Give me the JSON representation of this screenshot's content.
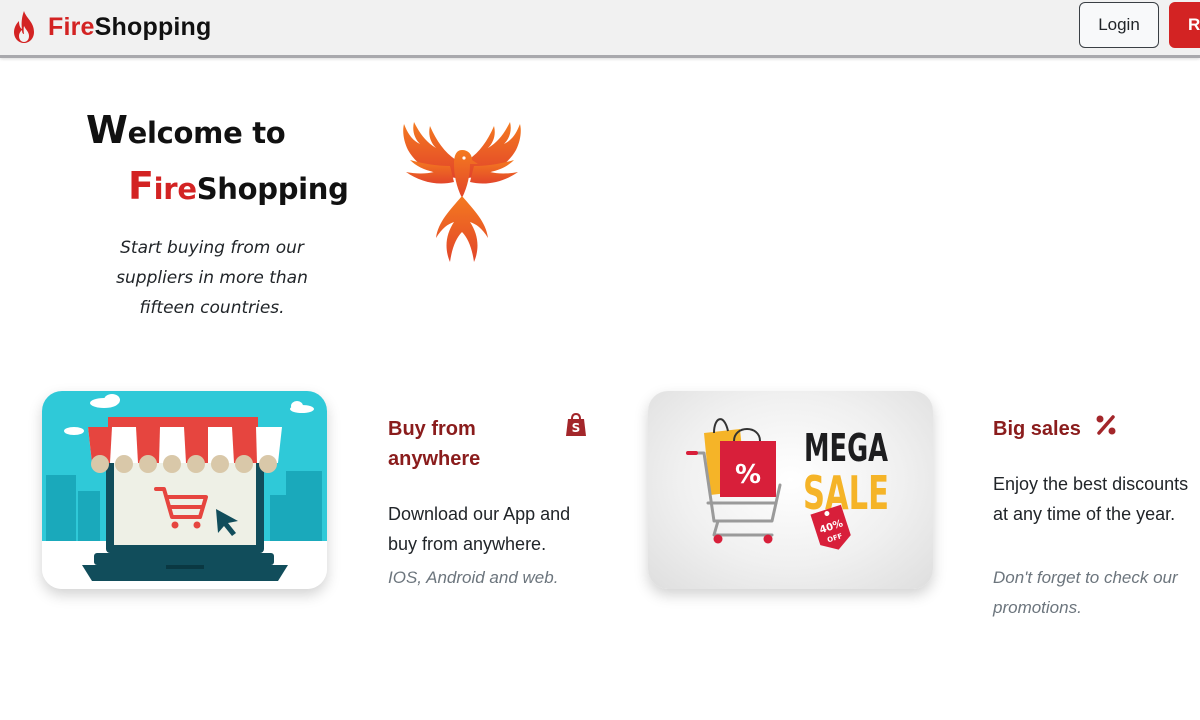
{
  "navbar": {
    "brand_red": "Fire",
    "brand_dark": "Shopping",
    "brand_icon": "flame-icon",
    "login_label": "Login",
    "register_label": "Re"
  },
  "hero": {
    "line1_cap": "W",
    "line1_rest": "elcome to",
    "line2_cap": "F",
    "line2_red": "ire",
    "line2_dark": "Shopping",
    "subtitle": "Start buying from our suppliers in more than fifteen countries.",
    "image": "phoenix-logo"
  },
  "features": [
    {
      "title": "Buy from anywhere",
      "icon": "shopify-bag-icon",
      "body": "Download our App and buy from anywhere.",
      "note": "IOS, Android and web.",
      "image": "online-store-laptop"
    },
    {
      "title": "Big sales",
      "icon": "percent-icon",
      "body": "Enjoy the best discounts at any time of the year.",
      "note": "Don't forget to check our promotions.",
      "image": "mega-sale-cart",
      "image_text_1": "MEGA",
      "image_text_2": "SALE",
      "badge_text": "40%",
      "badge_sub": "OFF"
    }
  ],
  "colors": {
    "brand_red": "#d32323",
    "feature_title": "#8a1c1c",
    "navbar_bg": "#f1f1f1"
  }
}
